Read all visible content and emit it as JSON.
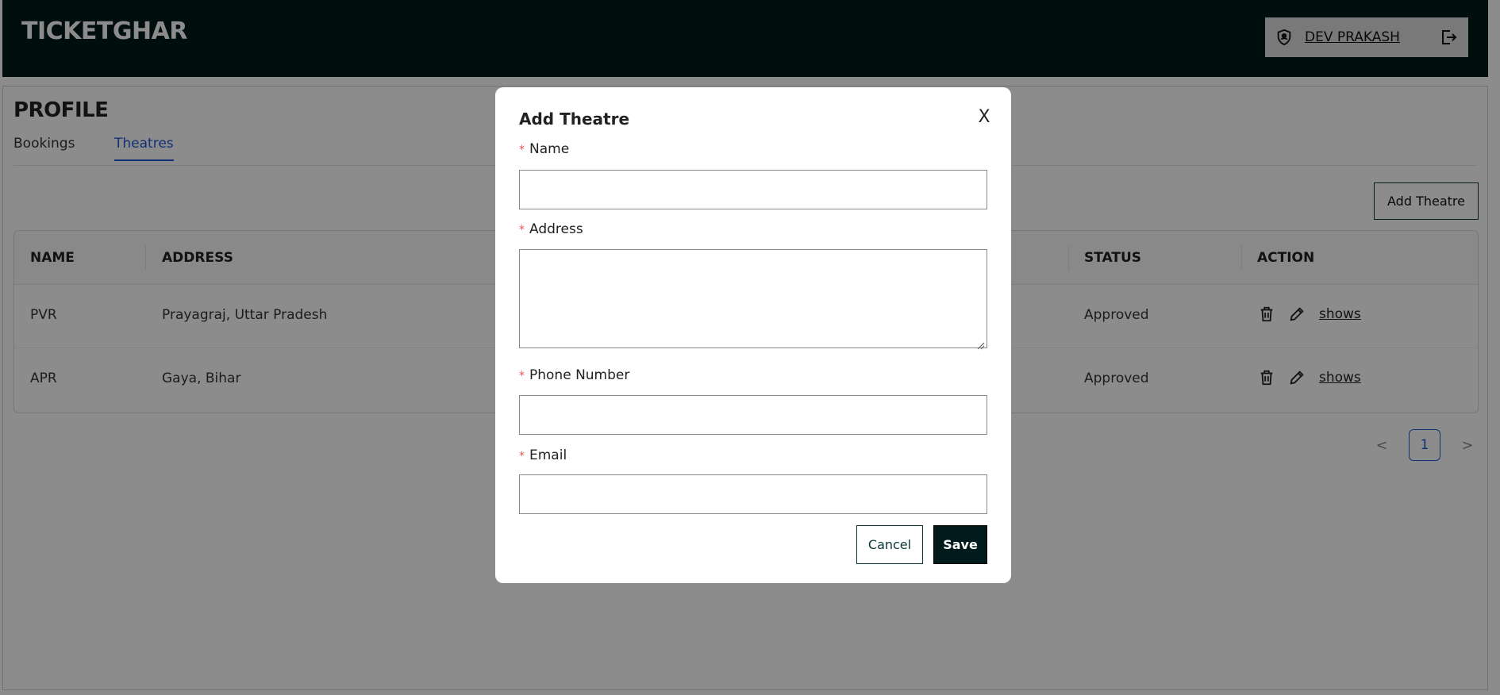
{
  "header": {
    "brand": "TICKETGHAR",
    "user_name": "DEV PRAKASH"
  },
  "page": {
    "title": "PROFILE",
    "tabs": [
      {
        "label": "Bookings"
      },
      {
        "label": "Theatres",
        "active": true
      }
    ],
    "add_button": "Add Theatre"
  },
  "table": {
    "columns": [
      "NAME",
      "ADDRESS",
      "STATUS",
      "ACTION"
    ],
    "rows": [
      {
        "name": "PVR",
        "address": "Prayagraj, Uttar Pradesh",
        "status": "Approved",
        "action_link": "shows"
      },
      {
        "name": "APR",
        "address": "Gaya, Bihar",
        "status": "Approved",
        "action_link": "shows"
      }
    ]
  },
  "pagination": {
    "prev": "<",
    "current": "1",
    "next": ">"
  },
  "modal": {
    "title": "Add Theatre",
    "close": "X",
    "required_mark": "*",
    "fields": [
      {
        "label": "Name",
        "value": ""
      },
      {
        "label": "Address",
        "value": ""
      },
      {
        "label": "Phone Number",
        "value": ""
      },
      {
        "label": "Email",
        "value": ""
      }
    ],
    "cancel_label": "Cancel",
    "save_label": "Save"
  },
  "colors": {
    "header_bg": "#011a1b",
    "accent": "#1f5ad3",
    "required": "#e35555",
    "overlay": "rgba(0,0,0,0.45)"
  },
  "icons": [
    "user-shield-icon",
    "logout-icon",
    "trash-icon",
    "edit-icon",
    "close-icon",
    "resize-grip-icon"
  ]
}
